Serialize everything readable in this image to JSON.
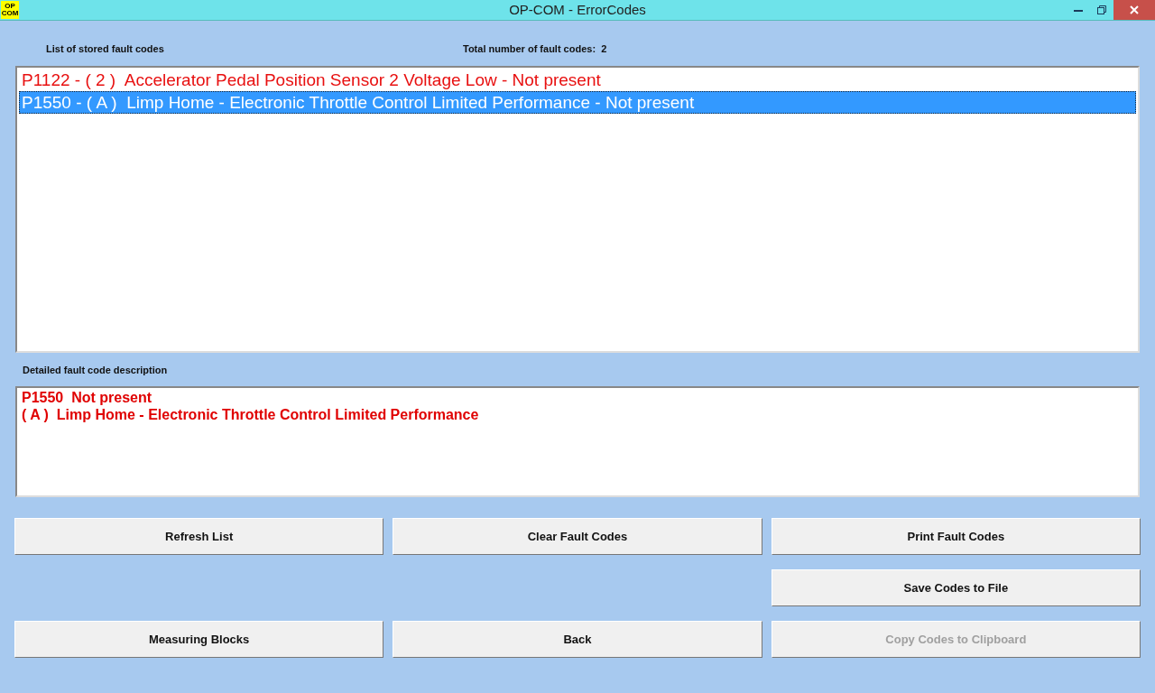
{
  "window": {
    "title": "OP-COM - ErrorCodes",
    "app_icon": "OP COM"
  },
  "list_label": "List of stored fault codes",
  "total_label": "Total number of fault codes:  2",
  "fault_codes": [
    {
      "text": "P1122 - ( 2 )  Accelerator Pedal Position Sensor 2 Voltage Low - Not present",
      "selected": false
    },
    {
      "text": "P1550 - ( A )  Limp Home - Electronic Throttle Control Limited Performance - Not present",
      "selected": true
    }
  ],
  "description_label": "Detailed fault code description",
  "description_lines": [
    "P1550  Not present",
    "( A )  Limp Home - Electronic Throttle Control Limited Performance"
  ],
  "button_rows": [
    [
      {
        "label": "Refresh List",
        "disabled": false
      },
      {
        "label": "Clear Fault Codes",
        "disabled": false
      },
      {
        "label": "Print Fault Codes",
        "disabled": false
      }
    ],
    [
      null,
      null,
      {
        "label": "Save Codes to File",
        "disabled": false
      }
    ],
    [
      {
        "label": "Measuring Blocks",
        "disabled": false
      },
      {
        "label": "Back",
        "disabled": false
      },
      {
        "label": "Copy Codes to Clipboard",
        "disabled": true
      }
    ]
  ]
}
